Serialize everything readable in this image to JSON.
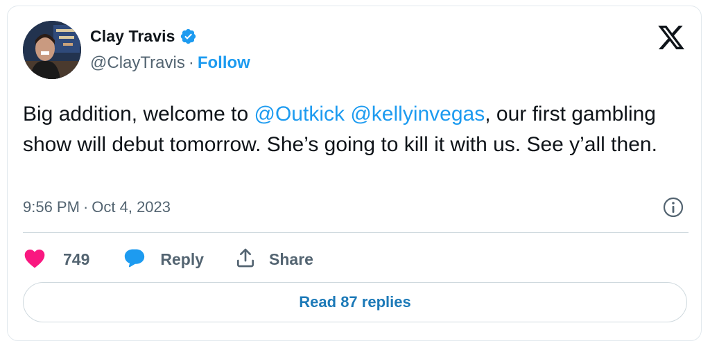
{
  "author": {
    "name": "Clay Travis",
    "handle": "@ClayTravis",
    "separator": "·",
    "follow_label": "Follow"
  },
  "tweet": {
    "text_parts": [
      "Big addition, welcome to ",
      "@Outkick",
      " ",
      "@kellyinvegas",
      ", our first gambling show will debut tomorrow. She’s going to kill it with us. See y’all then."
    ],
    "time": "9:56 PM",
    "date_separator": "·",
    "date": "Oct 4, 2023"
  },
  "actions": {
    "like_count": "749",
    "reply_label": "Reply",
    "share_label": "Share"
  },
  "read_replies_label": "Read 87 replies",
  "colors": {
    "accent": "#1d9bf0",
    "heart": "#f91880",
    "verified": "#1d9bf0",
    "muted": "#536471"
  },
  "icons": {
    "logo": "x-logo-icon",
    "verified": "verified-badge-icon",
    "info": "info-icon",
    "like": "heart-icon",
    "reply": "speech-bubble-icon",
    "share": "share-arrow-icon"
  }
}
